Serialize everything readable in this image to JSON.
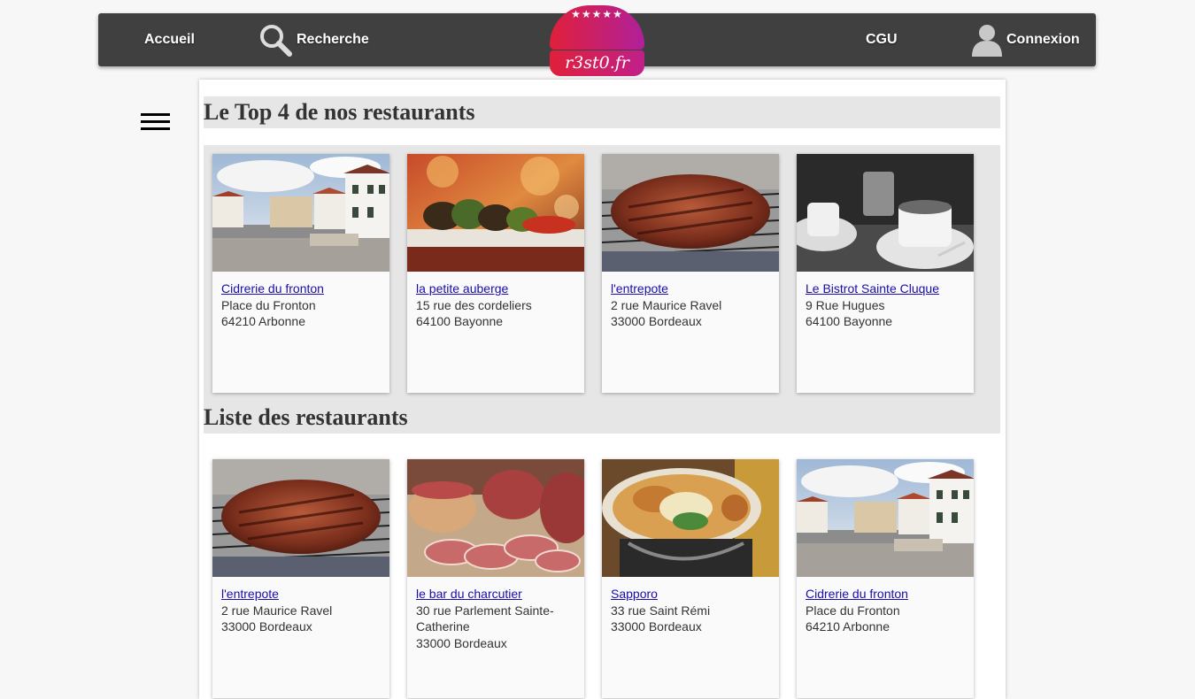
{
  "nav": {
    "home_label": "Accueil",
    "search_label": "Recherche",
    "cgu_label": "CGU",
    "login_label": "Connexion",
    "logo_stars": "★★★★★",
    "logo_text": "r3st0.fr"
  },
  "top_section": {
    "title": "Le Top 4 de nos restaurants",
    "cards": [
      {
        "name": "Cidrerie du fronton",
        "address": "Place du Fronton",
        "city": "64210 Arbonne",
        "image": "house-image"
      },
      {
        "name": "la petite auberge",
        "address": "15 rue des cordeliers",
        "city": "64100 Bayonne",
        "image": "skewer-image"
      },
      {
        "name": "l'entrepote",
        "address": "2 rue Maurice Ravel",
        "city": "33000 Bordeaux",
        "image": "steak-image"
      },
      {
        "name": "Le Bistrot Sainte Cluque",
        "address": "9 Rue Hugues",
        "city": "64100 Bayonne",
        "image": "coffee-image"
      }
    ]
  },
  "list_section": {
    "title": "Liste des restaurants",
    "cards": [
      {
        "name": "l'entrepote",
        "address": "2 rue Maurice Ravel",
        "city": "33000 Bordeaux",
        "image": "steak-image"
      },
      {
        "name": "le bar du charcutier",
        "address": "30 rue Parlement Sainte-Catherine",
        "city": "33000 Bordeaux",
        "image": "charcuterie-image"
      },
      {
        "name": "Sapporo",
        "address": "33 rue Saint Rémi",
        "city": "33000 Bordeaux",
        "image": "ramen-image"
      },
      {
        "name": "Cidrerie du fronton",
        "address": "Place du Fronton",
        "city": "64210 Arbonne",
        "image": "house-image"
      }
    ]
  },
  "colors": {
    "navbar": "#404040",
    "logo_gradient_start": "#e0203a",
    "logo_gradient_end": "#b0209a",
    "link": "#1a0dab",
    "section_bg": "#e6e6e6"
  }
}
